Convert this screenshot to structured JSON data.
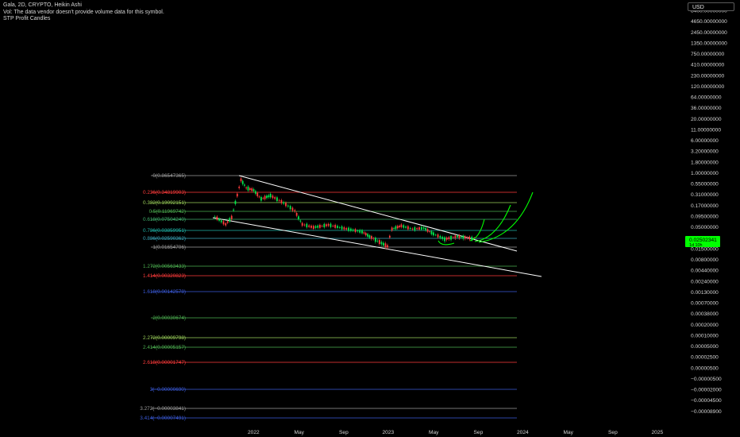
{
  "legend": {
    "title": "Gala, 2D, CRYPTO, Heikin Ashi",
    "volume_note": "Vol: The data vendor doesn't provide volume data for this symbol.",
    "indicator": "STP Profit Candles"
  },
  "currency_button": "USD",
  "price_tag": {
    "value": "0.02502341",
    "subtext": "1d 10h",
    "color": "#00ff00"
  },
  "colors": {
    "background": "#000000",
    "up": "#00e64d",
    "down": "#ff3b3b",
    "trendline": "#ffffff",
    "arrows": "#00ff00",
    "axis_text": "#d4d4d4"
  },
  "chart_data": {
    "type": "candlestick",
    "y_scale": "log",
    "y_ticks": [
      "8400.00000000",
      "4650.00000000",
      "2450.00000000",
      "1350.00000000",
      "750.00000000",
      "410.00000000",
      "230.00000000",
      "120.00000000",
      "64.00000000",
      "36.00000000",
      "20.00000000",
      "11.00000000",
      "6.00000000",
      "3.20000000",
      "1.80000000",
      "1.00000000",
      "0.55000000",
      "0.31000000",
      "0.17000000",
      "0.09500000",
      "0.05000000",
      "0.02500000",
      "0.01500000",
      "0.00800000",
      "0.00440000",
      "0.00240000",
      "0.00130000",
      "0.00070000",
      "0.00038000",
      "0.00020000",
      "0.00010000",
      "0.00005000",
      "0.00002500",
      "0.00000500",
      "−0.00000500",
      "−0.00002000",
      "−0.00004500",
      "−0.00008900"
    ],
    "x_ticks": [
      "2022",
      "May",
      "Sep",
      "2023",
      "May",
      "Sep",
      "2024",
      "May",
      "Sep",
      "2025"
    ],
    "fib_levels": [
      {
        "label": "0(0.86547365)",
        "color": "#9e9e9e"
      },
      {
        "label": "0.236(0.34819903)",
        "color": "#ff3b3b"
      },
      {
        "label": "0.382(0.19092151)",
        "color": "#9bd15a"
      },
      {
        "label": "0.5(0.11969742)",
        "color": "#4caf50"
      },
      {
        "label": "0.618(0.07504240)",
        "color": "#3fae6a"
      },
      {
        "label": "0.786(0.03859951)",
        "color": "#1fb5a8"
      },
      {
        "label": "0.886(0.02590362)",
        "color": "#3aa6b8"
      },
      {
        "label": "1(0.01654706)",
        "color": "#9e9e9e"
      },
      {
        "label": "1.272(0.00563433)",
        "color": "#4caf50"
      },
      {
        "label": "1.414(0.00320823)",
        "color": "#ff3b3b"
      },
      {
        "label": "1.618(0.00142578)",
        "color": "#3b5bdb"
      },
      {
        "label": "2(0.00030674)",
        "color": "#4caf50"
      },
      {
        "label": "2.272(0.00009798)",
        "color": "#9bd15a"
      },
      {
        "label": "2.414(0.00005157)",
        "color": "#4caf50"
      },
      {
        "label": "2.618(0.00001747)",
        "color": "#ff3b3b"
      },
      {
        "label": "3(−0.00000690)",
        "color": "#3b5bdb"
      },
      {
        "label": "3.272(−0.00003841)",
        "color": "#9e9e9e"
      },
      {
        "label": "3.414(−0.00007491)",
        "color": "#3b5bdb"
      }
    ],
    "price_series": [
      {
        "date": "2021-09-16",
        "open": 0.03,
        "close": 0.095,
        "high": 0.11,
        "low": 0.015
      },
      {
        "date": "2021-10-15",
        "open": 0.08,
        "close": 0.06,
        "high": 0.1,
        "low": 0.05
      },
      {
        "date": "2021-11-01",
        "open": 0.065,
        "close": 0.09,
        "high": 0.12,
        "low": 0.055
      },
      {
        "date": "2021-11-26",
        "open": 0.3,
        "close": 0.7,
        "high": 0.86,
        "low": 0.25
      },
      {
        "date": "2021-12-10",
        "open": 0.65,
        "close": 0.45,
        "high": 0.7,
        "low": 0.4
      },
      {
        "date": "2021-12-30",
        "open": 0.5,
        "close": 0.4,
        "high": 0.55,
        "low": 0.35
      },
      {
        "date": "2022-01-20",
        "open": 0.38,
        "close": 0.25,
        "high": 0.4,
        "low": 0.2
      },
      {
        "date": "2022-02-15",
        "open": 0.26,
        "close": 0.3,
        "high": 0.33,
        "low": 0.22
      },
      {
        "date": "2022-03-20",
        "open": 0.28,
        "close": 0.2,
        "high": 0.31,
        "low": 0.17
      },
      {
        "date": "2022-04-20",
        "open": 0.2,
        "close": 0.13,
        "high": 0.22,
        "low": 0.11
      },
      {
        "date": "2022-05-10",
        "open": 0.1,
        "close": 0.06,
        "high": 0.11,
        "low": 0.04
      },
      {
        "date": "2022-06-10",
        "open": 0.06,
        "close": 0.05,
        "high": 0.065,
        "low": 0.04
      },
      {
        "date": "2022-07-20",
        "open": 0.05,
        "close": 0.058,
        "high": 0.065,
        "low": 0.045
      },
      {
        "date": "2022-08-20",
        "open": 0.055,
        "close": 0.05,
        "high": 0.06,
        "low": 0.045
      },
      {
        "date": "2022-09-20",
        "open": 0.05,
        "close": 0.043,
        "high": 0.052,
        "low": 0.04
      },
      {
        "date": "2022-10-20",
        "open": 0.042,
        "close": 0.038,
        "high": 0.045,
        "low": 0.035
      },
      {
        "date": "2022-11-10",
        "open": 0.035,
        "close": 0.028,
        "high": 0.037,
        "low": 0.022
      },
      {
        "date": "2022-12-01",
        "open": 0.028,
        "close": 0.022,
        "high": 0.03,
        "low": 0.019
      },
      {
        "date": "2022-12-28",
        "open": 0.02,
        "close": 0.017,
        "high": 0.021,
        "low": 0.0155
      },
      {
        "date": "2023-01-10",
        "open": 0.02,
        "close": 0.045,
        "high": 0.05,
        "low": 0.019
      },
      {
        "date": "2023-02-05",
        "open": 0.045,
        "close": 0.055,
        "high": 0.06,
        "low": 0.04
      },
      {
        "date": "2023-03-05",
        "open": 0.052,
        "close": 0.045,
        "high": 0.055,
        "low": 0.04
      },
      {
        "date": "2023-04-05",
        "open": 0.046,
        "close": 0.048,
        "high": 0.05,
        "low": 0.042
      },
      {
        "date": "2023-05-01",
        "open": 0.04,
        "close": 0.033,
        "high": 0.042,
        "low": 0.03
      },
      {
        "date": "2023-06-01",
        "open": 0.03,
        "close": 0.024,
        "high": 0.032,
        "low": 0.02
      },
      {
        "date": "2023-07-05",
        "open": 0.025,
        "close": 0.028,
        "high": 0.03,
        "low": 0.023
      },
      {
        "date": "2023-08-01",
        "open": 0.028,
        "close": 0.026,
        "high": 0.029,
        "low": 0.024
      },
      {
        "date": "2023-08-20",
        "open": 0.026,
        "close": 0.025,
        "high": 0.027,
        "low": 0.024
      }
    ]
  }
}
